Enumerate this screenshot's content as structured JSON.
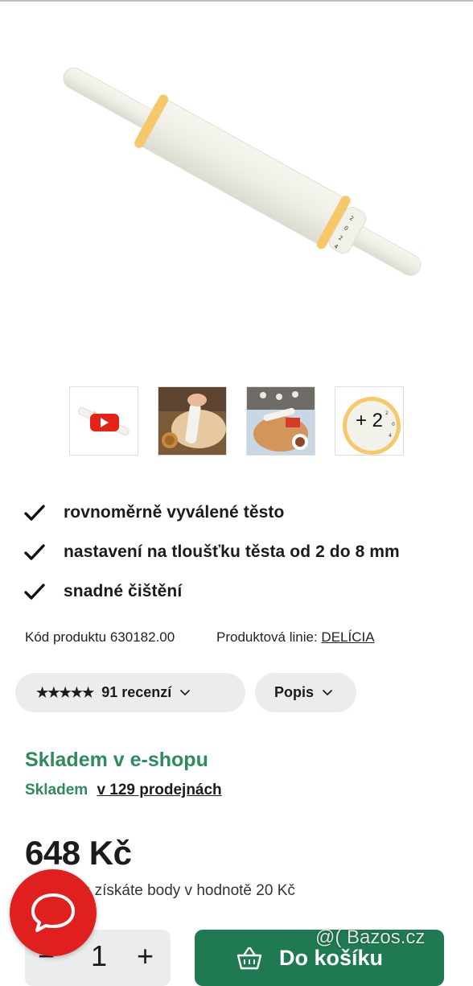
{
  "gallery": {
    "thumbnails": [
      {
        "kind": "video",
        "icon": "play-icon"
      },
      {
        "kind": "photo",
        "subject": "rolling-dough"
      },
      {
        "kind": "photo",
        "subject": "cookie-baking"
      },
      {
        "kind": "more",
        "label": "+ 2"
      }
    ]
  },
  "features": [
    {
      "text": "rovnoměrně vyválené těsto",
      "icon": "check-icon"
    },
    {
      "text": "nastavení na tloušťku těsta od 2 do 8 mm",
      "icon": "check-icon"
    },
    {
      "text": "snadné čištění",
      "icon": "check-icon"
    }
  ],
  "product": {
    "code_label": "Kód produktu 630182.00",
    "line_label": "Produktová linie:",
    "line_value": "DELÍCIA"
  },
  "tabs": {
    "stars": "★★★★★",
    "rating": 4.5,
    "reviews_label": "91 recenzí",
    "popis_label": "Popis"
  },
  "stock": {
    "title": "Skladem v e-shopu",
    "status": "Skladem",
    "stores_link": "v 129 prodejnách"
  },
  "price": {
    "amount": "648 Kč",
    "points_text": "Nákupem získáte body v hodnotě 20 Kč"
  },
  "cart": {
    "quantity": "1",
    "minus": "−",
    "plus": "+",
    "button_label": "Do košíku"
  },
  "watermark": "@( Bazos.cz",
  "colors": {
    "accent_green": "#1f7a52",
    "stock_green": "#2f8a5e",
    "chat_red": "#e0201f"
  }
}
